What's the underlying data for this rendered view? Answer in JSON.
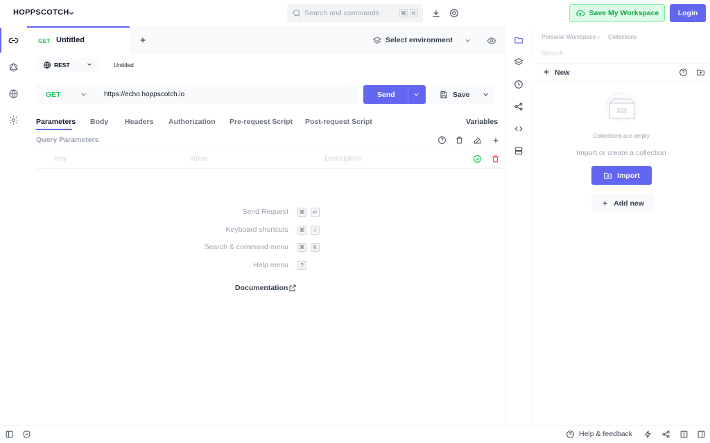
{
  "header": {
    "brand": "HOPPSCOTCH",
    "search_placeholder": "Search and commands",
    "search_keys": [
      "⌘",
      "K"
    ],
    "save_workspace_label": "Save My Workspace",
    "login_label": "Login"
  },
  "tab": {
    "method": "GET",
    "title": "Untitled"
  },
  "environment": {
    "label": "Select environment"
  },
  "request": {
    "protocol": "REST",
    "name": "Untitled",
    "method": "GET",
    "url": "https://echo.hoppscotch.io",
    "send_label": "Send",
    "save_label": "Save"
  },
  "request_tabs": [
    {
      "label": "Parameters",
      "active": true
    },
    {
      "label": "Body"
    },
    {
      "label": "Headers"
    },
    {
      "label": "Authorization"
    },
    {
      "label": "Pre-request Script"
    },
    {
      "label": "Post-request Script"
    }
  ],
  "variables_label": "Variables",
  "query_params": {
    "title": "Query Parameters",
    "key_placeholder": "Key",
    "value_placeholder": "Value",
    "description_placeholder": "Description"
  },
  "shortcuts": [
    {
      "label": "Send Request",
      "keys": [
        "⌘",
        "↵"
      ]
    },
    {
      "label": "Keyboard shortcuts",
      "keys": [
        "⌘",
        "/"
      ]
    },
    {
      "label": "Search & command menu",
      "keys": [
        "⌘",
        "K"
      ]
    },
    {
      "label": "Help menu",
      "keys": [
        "?"
      ]
    }
  ],
  "documentation_label": "Documentation",
  "collections": {
    "breadcrumb": [
      "Personal Workspace",
      "Collections"
    ],
    "search_placeholder": "Search",
    "new_label": "New",
    "empty_text": "Collections are empty",
    "import_hint": "Import or create a collection",
    "import_label": "Import",
    "add_new_label": "Add new"
  },
  "footer": {
    "help_label": "Help & feedback"
  },
  "colors": {
    "accent": "#6366f1",
    "method_get": "#22c55e",
    "danger": "#ef4444"
  }
}
